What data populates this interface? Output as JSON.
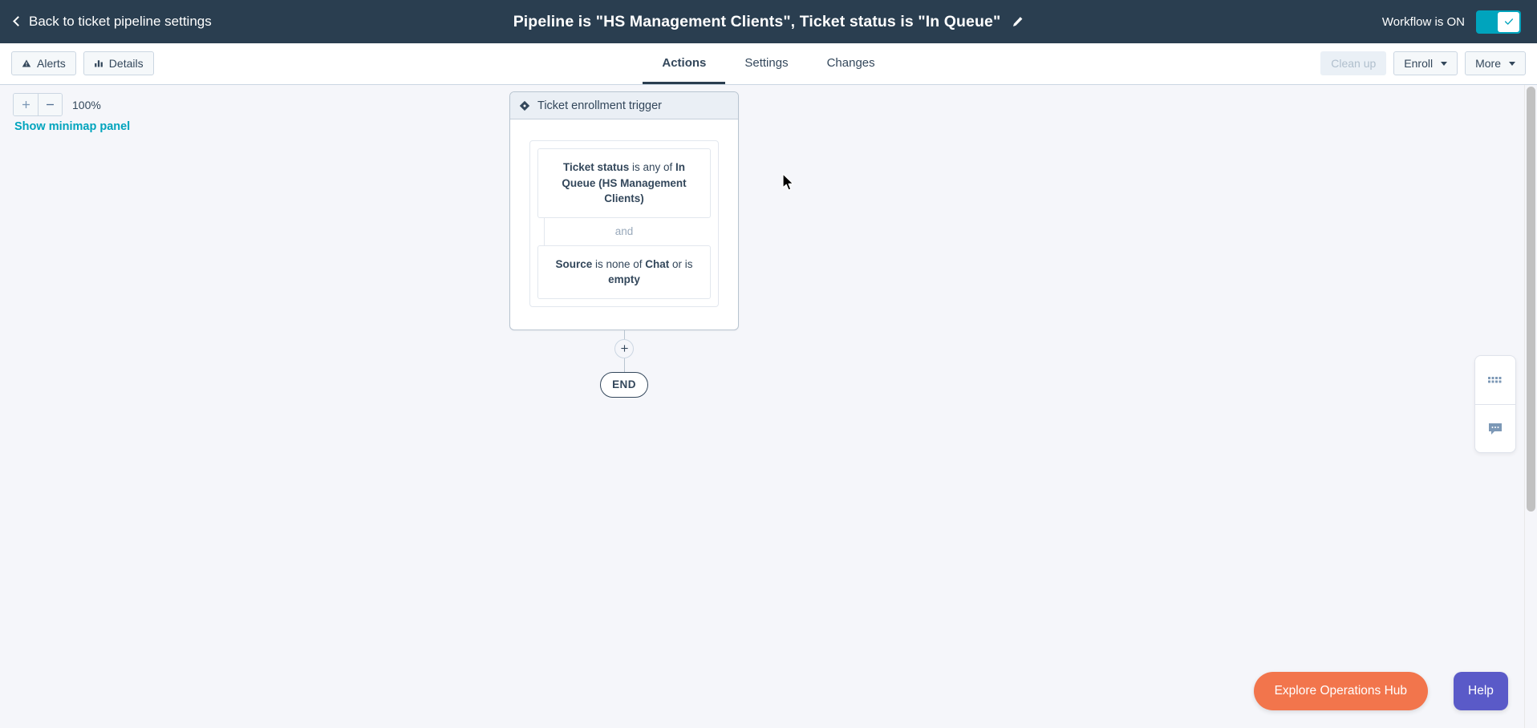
{
  "topbar": {
    "back_label": "Back to ticket pipeline settings",
    "back_icon": "chevron-left-icon",
    "title": "Pipeline is \"HS Management Clients\", Ticket status is \"In Queue\"",
    "edit_icon": "pencil-icon",
    "workflow_status_label": "Workflow is ON",
    "toggle_state": "on",
    "toggle_icon": "check-icon",
    "toggle_color": "#00a4bd",
    "background_color": "#2a3e50"
  },
  "toolbar": {
    "left_buttons": [
      {
        "label": "Alerts",
        "icon": "warning-triangle-icon"
      },
      {
        "label": "Details",
        "icon": "bar-chart-icon"
      }
    ],
    "tabs": [
      {
        "label": "Actions",
        "active": true
      },
      {
        "label": "Settings",
        "active": false
      },
      {
        "label": "Changes",
        "active": false
      }
    ],
    "right_buttons": [
      {
        "label": "Clean up",
        "disabled": true,
        "caret": false
      },
      {
        "label": "Enroll",
        "disabled": false,
        "caret": true
      },
      {
        "label": "More",
        "disabled": false,
        "caret": true
      }
    ]
  },
  "canvas": {
    "zoom": {
      "plus_icon": "plus-icon",
      "minus_icon": "minus-icon",
      "level": "100%"
    },
    "minimap_link": "Show minimap panel",
    "minimap_link_color": "#00a4bd",
    "background_color": "#f5f6fa"
  },
  "flow": {
    "trigger": {
      "header_label": "Ticket enrollment trigger",
      "header_icon": "diamond-filter-icon",
      "conditions": [
        {
          "parts": [
            {
              "text": "Ticket status",
              "bold": true
            },
            {
              "text": " is any of ",
              "bold": false
            },
            {
              "text": "In Queue (HS Management Clients)",
              "bold": true
            }
          ]
        },
        {
          "parts": [
            {
              "text": "Source",
              "bold": true
            },
            {
              "text": " is none of ",
              "bold": false
            },
            {
              "text": "Chat",
              "bold": true
            },
            {
              "text": " or is ",
              "bold": false
            },
            {
              "text": "empty",
              "bold": true
            }
          ]
        }
      ],
      "connector_label": "and"
    },
    "add_step_icon": "plus-circle-icon",
    "end_label": "END"
  },
  "side_panel": {
    "buttons": [
      {
        "icon": "grid-dots-icon",
        "name": "apps-grid"
      },
      {
        "icon": "chat-bubble-icon",
        "name": "chat"
      }
    ]
  },
  "footer": {
    "ops_hub_label": "Explore Operations Hub",
    "ops_hub_color": "#f2754c",
    "help_label": "Help",
    "help_color": "#5a5ac8"
  }
}
